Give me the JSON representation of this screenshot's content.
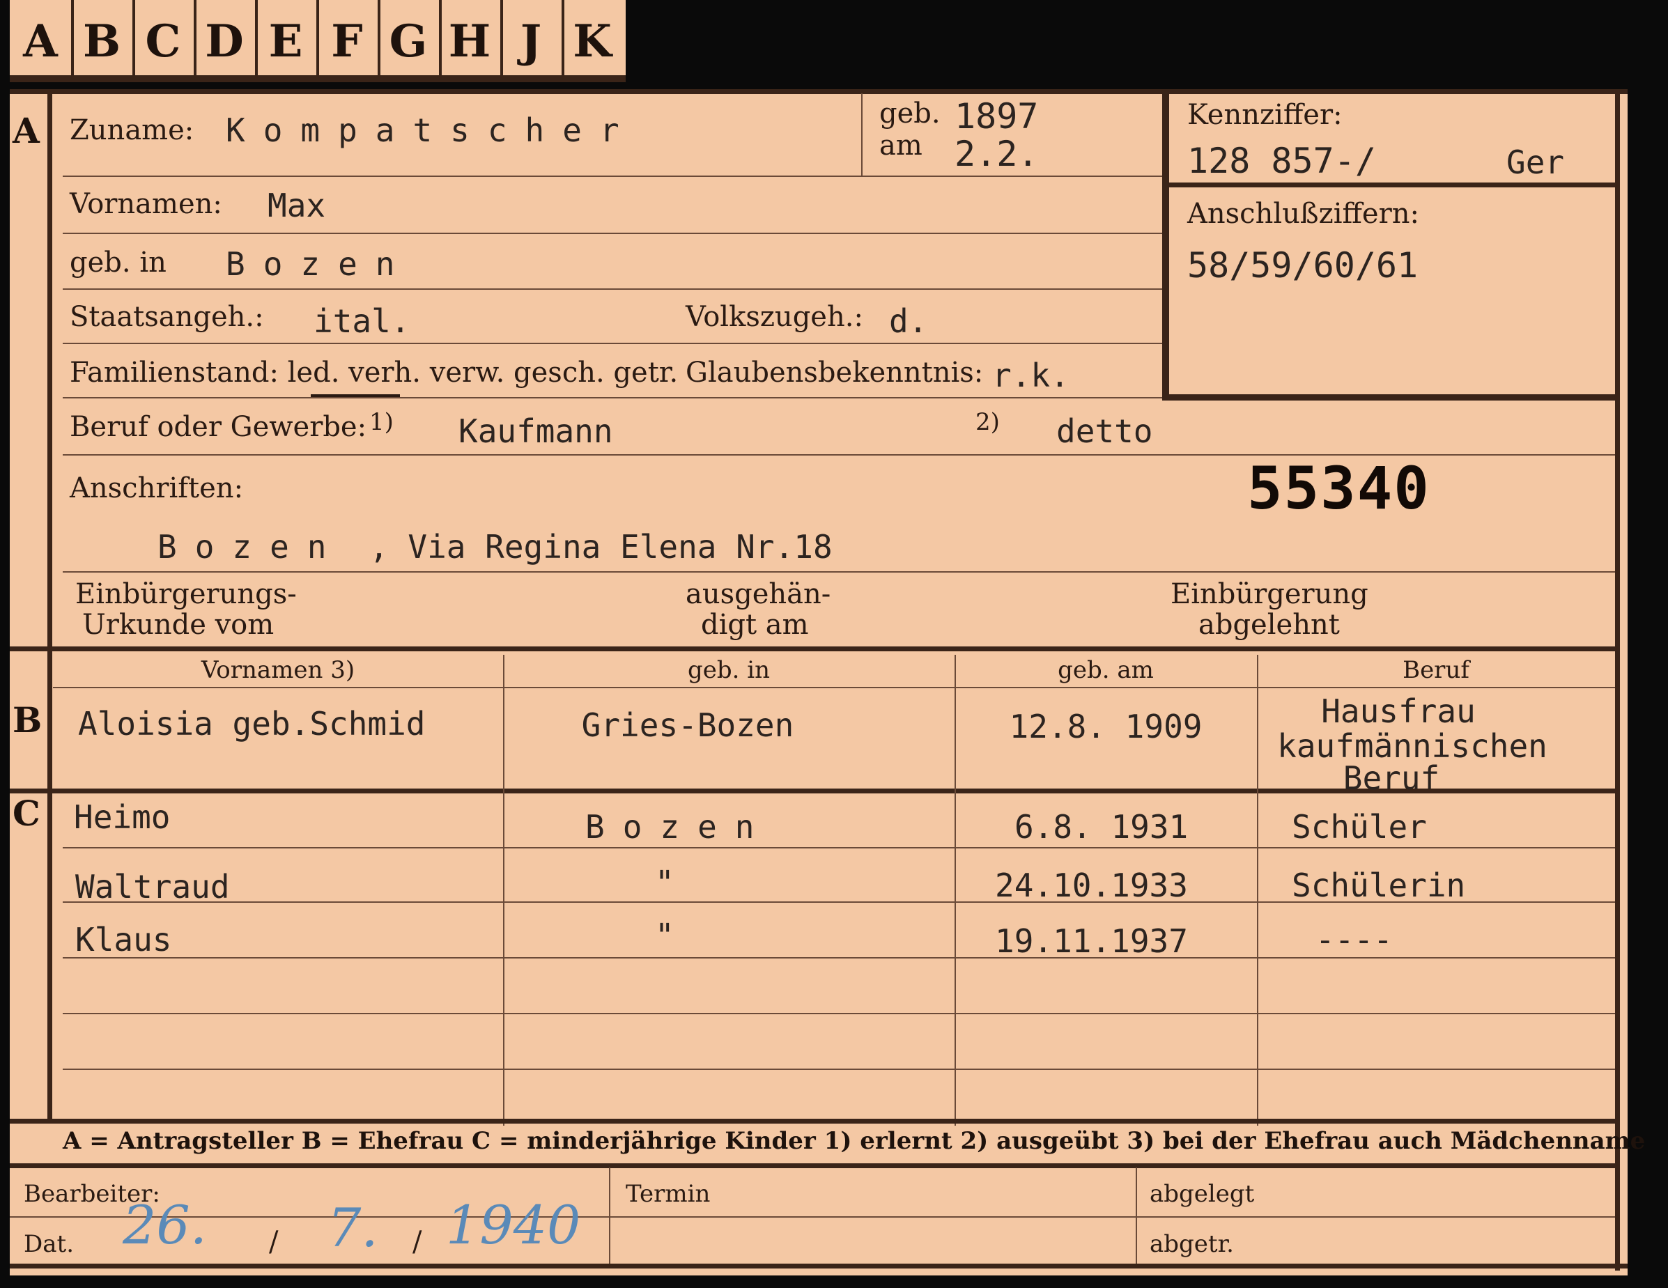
{
  "tabs": [
    "A",
    "B",
    "C",
    "D",
    "E",
    "F",
    "G",
    "H",
    "J",
    "K"
  ],
  "section_a": {
    "marker": "A",
    "zuname_label": "Zuname:",
    "zuname_value": "Kompatscher",
    "geb_label": "geb.",
    "am_label": "am",
    "geb_year": "1897",
    "geb_day": "2.2.",
    "kennziffer_label": "Kennziffer:",
    "kennziffer_value": "128 857-/",
    "kennziffer_suffix": "Ger",
    "anschluss_label": "Anschlußziffern:",
    "anschluss_value": "58/59/60/61",
    "vornamen_label": "Vornamen:",
    "vornamen_value": "Max",
    "gebin_label": "geb. in",
    "gebin_value": "Bozen",
    "staats_label": "Staatsangeh.:",
    "staats_value": "ital.",
    "volks_label": "Volkszugeh.:",
    "volks_value": "d.",
    "familien_label": "Familienstand: led. verh. verw. gesch. getr.",
    "glaubens_label": "Glaubensbekenntnis:",
    "glaubens_value": "r.k.",
    "beruf_label": "Beruf oder Gewerbe:",
    "beruf_note1": "1)",
    "beruf_value1": "Kaufmann",
    "beruf_note2": "2)",
    "beruf_value2": "detto",
    "anschriften_label": "Anschriften:",
    "stamp_number": "55340",
    "address_city": "Bozen",
    "address_rest": ", Via Regina Elena Nr.18",
    "einb_urkunde_l1": "Einbürgerungs-",
    "einb_urkunde_l2": "Urkunde vom",
    "ausgeh_l1": "ausgehän-",
    "ausgeh_l2": "digt am",
    "einb_abgelehnt_l1": "Einbürgerung",
    "einb_abgelehnt_l2": "abgelehnt"
  },
  "section_b": {
    "marker": "B",
    "headers": [
      "Vornamen 3)",
      "geb. in",
      "geb. am",
      "Beruf"
    ],
    "row": {
      "vornamen": "Aloisia geb.Schmid",
      "gebin": "Gries-Bozen",
      "gebam": "12.8. 1909",
      "beruf_l1": "Hausfrau",
      "beruf_l2": "kaufmännischen",
      "beruf_l3": "Beruf"
    }
  },
  "section_c": {
    "marker": "C",
    "rows": [
      {
        "name": "Heimo",
        "gebin": "Bozen",
        "gebam": "6.8. 1931",
        "beruf": "Schüler"
      },
      {
        "name": "Waltraud",
        "gebin": "\"",
        "gebam": "24.10.1933",
        "beruf": "Schülerin"
      },
      {
        "name": "Klaus",
        "gebin": "\"",
        "gebam": "19.11.1937",
        "beruf": "----"
      }
    ]
  },
  "legend": "A = Antragsteller   B = Ehefrau   C = minderjährige Kinder   1) erlernt   2) ausgeübt   3) bei der Ehefrau auch Mädchenname",
  "footer": {
    "bearbeiter_label": "Bearbeiter:",
    "dat_label": "Dat.",
    "date_day": "26.",
    "date_sep1": "/",
    "date_month": "7.",
    "date_sep2": "/",
    "date_year": "1940",
    "termin_label": "Termin",
    "abgelegt_label": "abgelegt",
    "abgetr_label": "abgetr."
  },
  "colors": {
    "card": "#f4c8a4",
    "ink": "#2a1a12",
    "handwriting": "#5a8ab8",
    "background": "#0a0a0a"
  }
}
